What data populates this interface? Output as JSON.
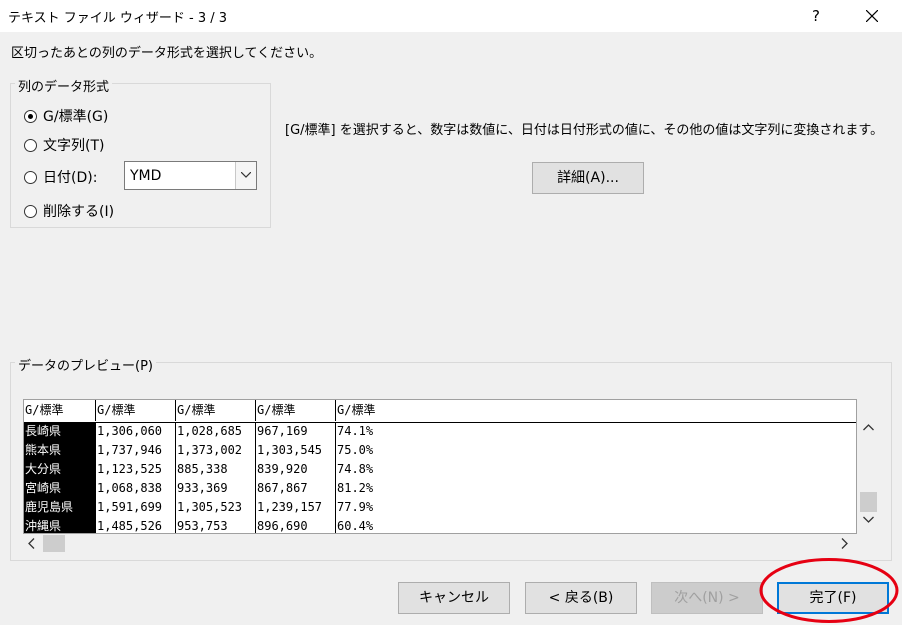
{
  "window": {
    "title": "テキスト ファイル ウィザード - 3 / 3",
    "help": "?"
  },
  "instruction": "区切ったあとの列のデータ形式を選択してください。",
  "column_format": {
    "legend": "列のデータ形式",
    "options": [
      {
        "label": "G/標準(G)",
        "checked": true
      },
      {
        "label": "文字列(T)",
        "checked": false
      },
      {
        "label": "日付(D):",
        "checked": false
      },
      {
        "label": "削除する(I)",
        "checked": false
      }
    ],
    "date_format": "YMD"
  },
  "description": "[G/標準] を選択すると、数字は数値に、日付は日付形式の値に、その他の値は文字列に変換されます。",
  "detail_button": "詳細(A)...",
  "preview": {
    "legend": "データのプレビュー(P)",
    "headers": [
      "G/標準",
      "G/標準",
      "G/標準",
      "G/標準",
      "G/標準"
    ],
    "rows": [
      [
        "長崎県",
        "1,306,060",
        "1,028,685",
        "967,169",
        "74.1%"
      ],
      [
        "熊本県",
        "1,737,946",
        "1,373,002",
        "1,303,545",
        "75.0%"
      ],
      [
        "大分県",
        "1,123,525",
        "885,338",
        "839,920",
        "74.8%"
      ],
      [
        "宮崎県",
        "1,068,838",
        "933,369",
        "867,867",
        "81.2%"
      ],
      [
        "鹿児島県",
        "1,591,699",
        "1,305,523",
        "1,239,157",
        "77.9%"
      ],
      [
        "沖縄県",
        "1,485,526",
        "953,753",
        "896,690",
        "60.4%"
      ]
    ]
  },
  "buttons": {
    "cancel": "キャンセル",
    "back": "< 戻る(B)",
    "next": "次へ(N) >",
    "finish": "完了(F)"
  },
  "colors": {
    "focus_border": "#0078d7",
    "annotation": "#e60012",
    "selected_column": "#000000"
  },
  "icons": [
    "close-icon",
    "chevron-down-icon",
    "chevron-up-icon",
    "chevron-left-icon",
    "chevron-right-icon"
  ]
}
